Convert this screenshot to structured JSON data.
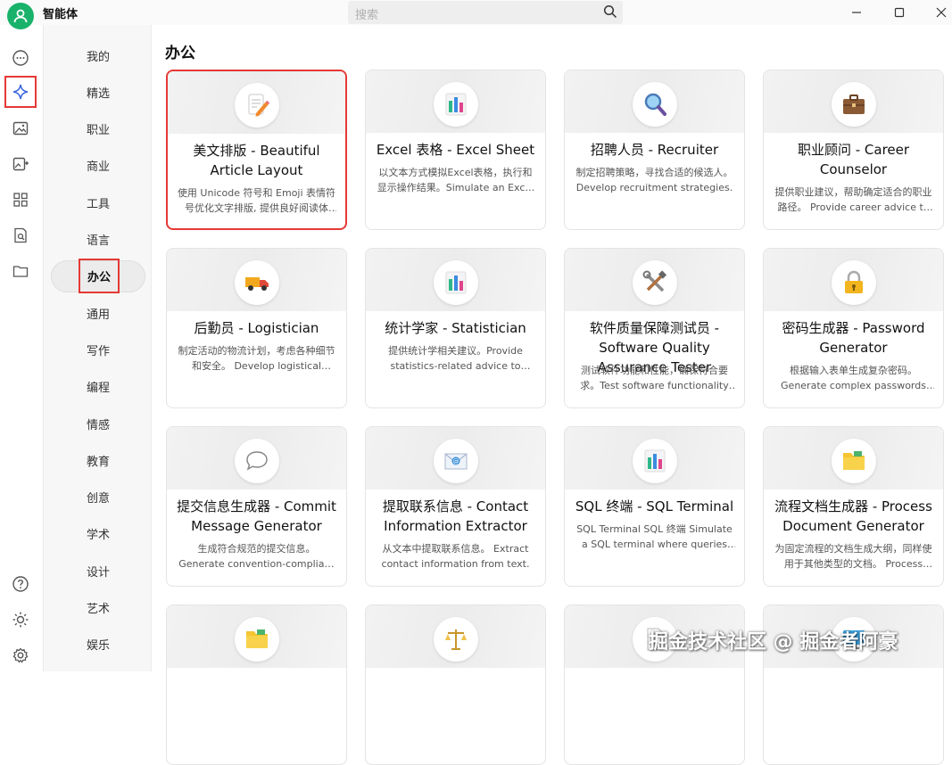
{
  "app": {
    "title": "智能体"
  },
  "search": {
    "placeholder": "搜索"
  },
  "rail": [
    {
      "name": "chat-icon"
    },
    {
      "name": "sparkle-icon"
    },
    {
      "name": "image-icon"
    },
    {
      "name": "image-edit-icon"
    },
    {
      "name": "apps-grid-icon"
    },
    {
      "name": "doc-search-icon"
    },
    {
      "name": "folder-icon"
    }
  ],
  "rail_bottom": [
    {
      "name": "help-icon"
    },
    {
      "name": "theme-sun-icon"
    },
    {
      "name": "settings-icon"
    }
  ],
  "categories": [
    "我的",
    "精选",
    "职业",
    "商业",
    "工具",
    "语言",
    "办公",
    "通用",
    "写作",
    "编程",
    "情感",
    "教育",
    "创意",
    "学术",
    "设计",
    "艺术",
    "娱乐"
  ],
  "active_category": "办公",
  "section": {
    "title": "办公"
  },
  "cards": [
    {
      "title": "美文排版 - Beautiful Article Layout",
      "desc": "使用 Unicode 符号和 Emoji 表情符号优化文字排版, 提供良好阅读体验。",
      "icon": "memo-pencil-icon"
    },
    {
      "title": "Excel 表格 - Excel Sheet",
      "desc": "以文本方式模拟Excel表格，执行和显示操作结果。Simulate an Excel sheet in text form.",
      "icon": "bar-chart-icon"
    },
    {
      "title": "招聘人员 - Recruiter",
      "desc": "制定招聘策略，寻找合适的候选人。Develop recruitment strategies.",
      "icon": "magnifier-icon"
    },
    {
      "title": "职业顾问 - Career Counselor",
      "desc": "提供职业建议，帮助确定适合的职业路径。 Provide career advice to users.",
      "icon": "briefcase-icon"
    },
    {
      "title": "后勤员 - Logistician",
      "desc": "制定活动的物流计划，考虑各种细节和安全。 Develop logistical plans.",
      "icon": "truck-icon"
    },
    {
      "title": "统计学家 - Statistician",
      "desc": "提供统计学相关建议。Provide statistics-related advice to users.",
      "icon": "bar-chart-icon"
    },
    {
      "title": "软件质量保障测试员 - Software Quality Assurance Tester",
      "desc": "测试软件功能和性能，确保符合要求。Test software functionality and performance.",
      "icon": "tools-icon"
    },
    {
      "title": "密码生成器 - Password Generator",
      "desc": "根据输入表单生成复杂密码。 Generate complex passwords from input.",
      "icon": "lock-key-icon"
    },
    {
      "title": "提交信息生成器 - Commit Message Generator",
      "desc": "生成符合规范的提交信息。 Generate convention-compliant commit messages.",
      "icon": "speech-bubble-icon"
    },
    {
      "title": "提取联系信息 - Contact Information Extractor",
      "desc": "从文本中提取联系信息。 Extract contact information from text.",
      "icon": "email-envelope-icon"
    },
    {
      "title": "SQL 终端 - SQL Terminal",
      "desc": "SQL Terminal SQL 终端 Simulate a SQL terminal where queries are executed.",
      "icon": "bar-chart-icon"
    },
    {
      "title": "流程文档生成器 - Process Document Generator",
      "desc": "为固定流程的文档生成大纲，同样使用于其他类型的文档。 Process documents.",
      "icon": "folder-icon"
    },
    {
      "title": "",
      "desc": "",
      "icon": "folder-icon"
    },
    {
      "title": "",
      "desc": "",
      "icon": "scales-icon"
    },
    {
      "title": "",
      "desc": "",
      "icon": "document-icon"
    },
    {
      "title": "",
      "desc": "",
      "icon": "monitor-icon"
    }
  ],
  "watermark": "掘金技术社区 @ 掘金者阿豪"
}
